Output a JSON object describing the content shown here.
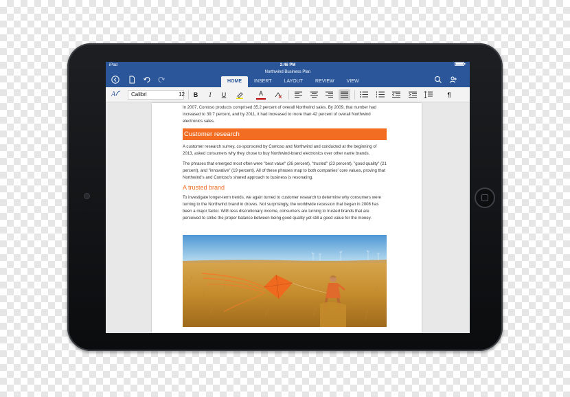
{
  "status_bar": {
    "device": "iPad",
    "time": "2:46 PM"
  },
  "document": {
    "title": "Northwind Business Plan"
  },
  "tabs": [
    {
      "label": "HOME",
      "active": true
    },
    {
      "label": "INSERT",
      "active": false
    },
    {
      "label": "LAYOUT",
      "active": false
    },
    {
      "label": "REVIEW",
      "active": false
    },
    {
      "label": "VIEW",
      "active": false
    }
  ],
  "ribbon": {
    "font_name": "Calibri",
    "font_size": "12",
    "bold": "B",
    "italic": "I",
    "underline": "U",
    "font_color": "A"
  },
  "content": {
    "intro": "In 2007, Contoso products comprised 35.2 percent of overall Northwind sales. By 2009, that number had increased to 39.7 percent, and by 2011, it had increased to more than 42 percent of overall Northwind electronics sales.",
    "heading1": "Customer research",
    "para1": "A customer research survey, co-sponsored by Contoso and Northwind and conducted at the beginning of 2013, asked consumers why they chose to buy Northwind-brand electronics over other name brands.",
    "para2": "The phrases that emerged most often were \"best value\" (26 percent), \"trusted\" (23 percent), \"good quality\" (21 percent), and \"innovative\" (19 percent). All of these phrases map to both companies' core values, proving that Northwind's and Contoso's shared approach to business is resonating.",
    "heading2": "A trusted brand",
    "para3": "To investigate longer-term trends, we again turned to customer research to determine why consumers were turning to the Northwind brand in droves. Not surprisingly, the worldwide recession that began in 2008 has been a major factor. With less discretionary income, consumers are turning to trusted brands that are perceived to strike the proper balance between being good quality yet still a good value for the money."
  },
  "colors": {
    "word_blue": "#2b579a",
    "accent_orange": "#f26c22",
    "tablet_black": "#101214"
  }
}
